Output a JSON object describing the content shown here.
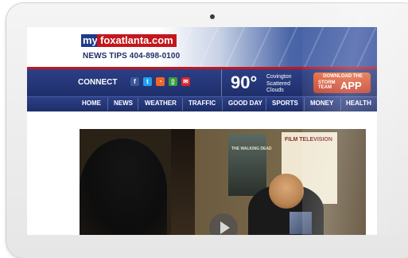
{
  "site": {
    "logo_my": "my",
    "logo_name": "foxatlanta.com",
    "news_tips": "NEWS TIPS 404-898-0100"
  },
  "connect": {
    "label": "CONNECT",
    "social": [
      {
        "icon": "facebook-icon",
        "glyph": "f",
        "color": "#3b5998"
      },
      {
        "icon": "twitter-icon",
        "glyph": "t",
        "color": "#1da1f2"
      },
      {
        "icon": "rss-icon",
        "glyph": "◔",
        "color": "#f26522"
      },
      {
        "icon": "mobile-icon",
        "glyph": "▯",
        "color": "#3a9d3a"
      },
      {
        "icon": "email-icon",
        "glyph": "✉",
        "color": "#d9262c"
      }
    ]
  },
  "weather": {
    "temp": "90°",
    "location": "Covington",
    "condition": "Scattered Clouds"
  },
  "app_promo": {
    "top": "DOWNLOAD THE",
    "storm": "STORM TEAM",
    "big": "APP"
  },
  "nav": [
    "HOME",
    "NEWS",
    "WEATHER",
    "TRAFFIC",
    "GOOD DAY",
    "SPORTS",
    "MONEY",
    "HEALTH"
  ],
  "video": {
    "poster1_text": "THE WALKING DEAD",
    "poster2_text": "FILM TELEVISION"
  },
  "colors": {
    "nav_bg": "#1f2f6b",
    "brand_red": "#c4161c"
  }
}
